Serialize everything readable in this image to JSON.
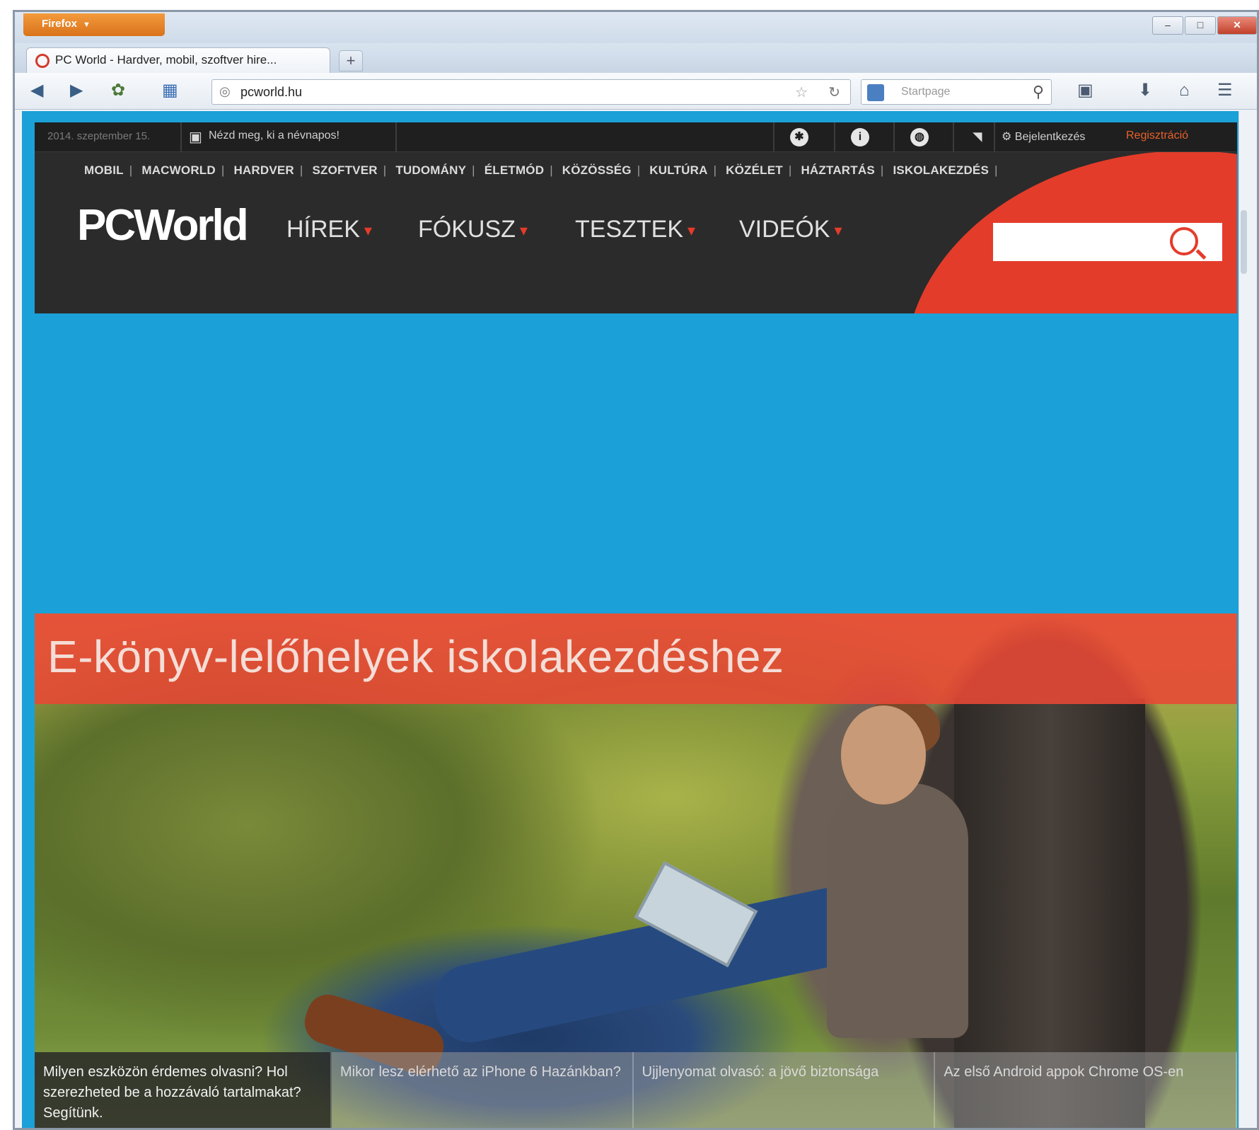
{
  "browser": {
    "app_button_label": "Firefox",
    "tab_title": "PC World - Hardver, mobil, szoftver hire...",
    "new_tab_label": "+",
    "url": "pcworld.hu",
    "search_placeholder": "Startpage",
    "window_controls": {
      "minimize": "–",
      "maximize": "□",
      "close": "✕"
    }
  },
  "site": {
    "date": "2014. szeptember 15.",
    "name_days_label": "Nézd meg, ki a névnapos!",
    "login_label": "Bejelentkezés",
    "register_label": "Regisztráció",
    "category_nav": [
      "MOBIL",
      "MACWORLD",
      "HARDVER",
      "SZOFTVER",
      "TUDOMÁNY",
      "ÉLETMÓD",
      "KÖZÖSSÉG",
      "KULTÚRA",
      "KÖZÉLET",
      "HÁZTARTÁS",
      "ISKOLAKEZDÉS"
    ],
    "logo_text": "PCWorld",
    "main_nav": [
      "HÍREK",
      "FÓKUSZ",
      "TESZTEK",
      "VIDEÓK"
    ],
    "colors": {
      "accent": "#e43c2a",
      "page_bg": "#1ba0d8",
      "header_bg": "#2b2b2b"
    }
  },
  "hero": {
    "title": "E-könyv-lelőhelyek iskolakezdéshez",
    "stories": [
      "Milyen eszközön érdemes olvasni? Hol szerezheted be a hozzávaló tartalmakat? Segítünk.",
      "Mikor lesz elérhető az iPhone 6 Hazánkban?",
      "Ujjlenyomat olvasó: a jövő biztonsága",
      "Az első Android appok Chrome OS-en"
    ]
  }
}
